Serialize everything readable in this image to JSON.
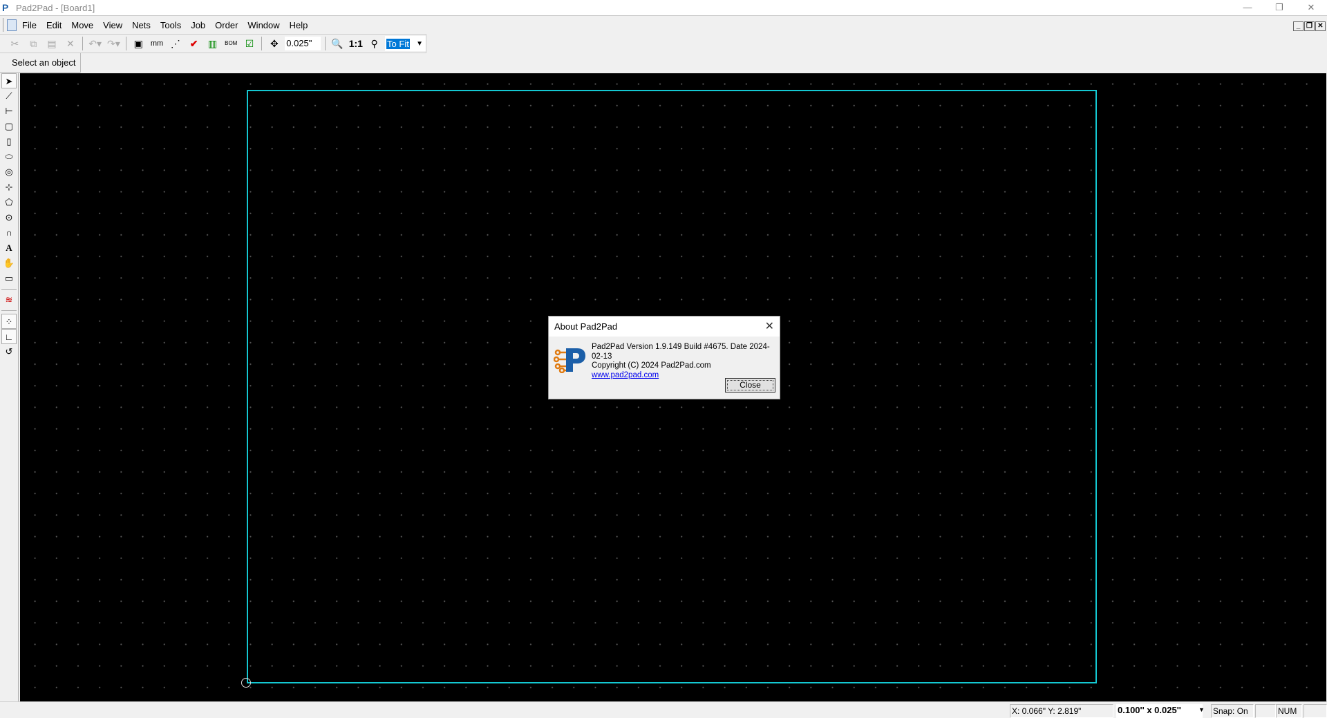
{
  "window": {
    "title": "Pad2Pad - [Board1]",
    "minimize": "—",
    "restore": "❐",
    "close": "✕"
  },
  "menu": [
    "File",
    "Edit",
    "Move",
    "View",
    "Nets",
    "Tools",
    "Job",
    "Order",
    "Window",
    "Help"
  ],
  "toolbar": {
    "grid_value": "0.025\"",
    "zoom_value": "To Fit",
    "one_to_one": "1:1",
    "mm_label": "mm",
    "bom_label": "BOM"
  },
  "prompt": "Select an object",
  "dialog": {
    "title": "About Pad2Pad",
    "version": "Pad2Pad Version 1.9.149 Build #4675. Date 2024-02-13",
    "copyright": "Copyright (C) 2024 Pad2Pad.com",
    "link": "www.pad2pad.com",
    "close_label": "Close"
  },
  "status": {
    "coords": "X: 0.066\" Y: 2.819\"",
    "grid": "0.100'' x 0.025''",
    "snap": "Snap: On",
    "num": "NUM"
  },
  "colors": {
    "board_outline": "#14c8d2",
    "canvas": "#000000",
    "selection": "#0078d7"
  }
}
